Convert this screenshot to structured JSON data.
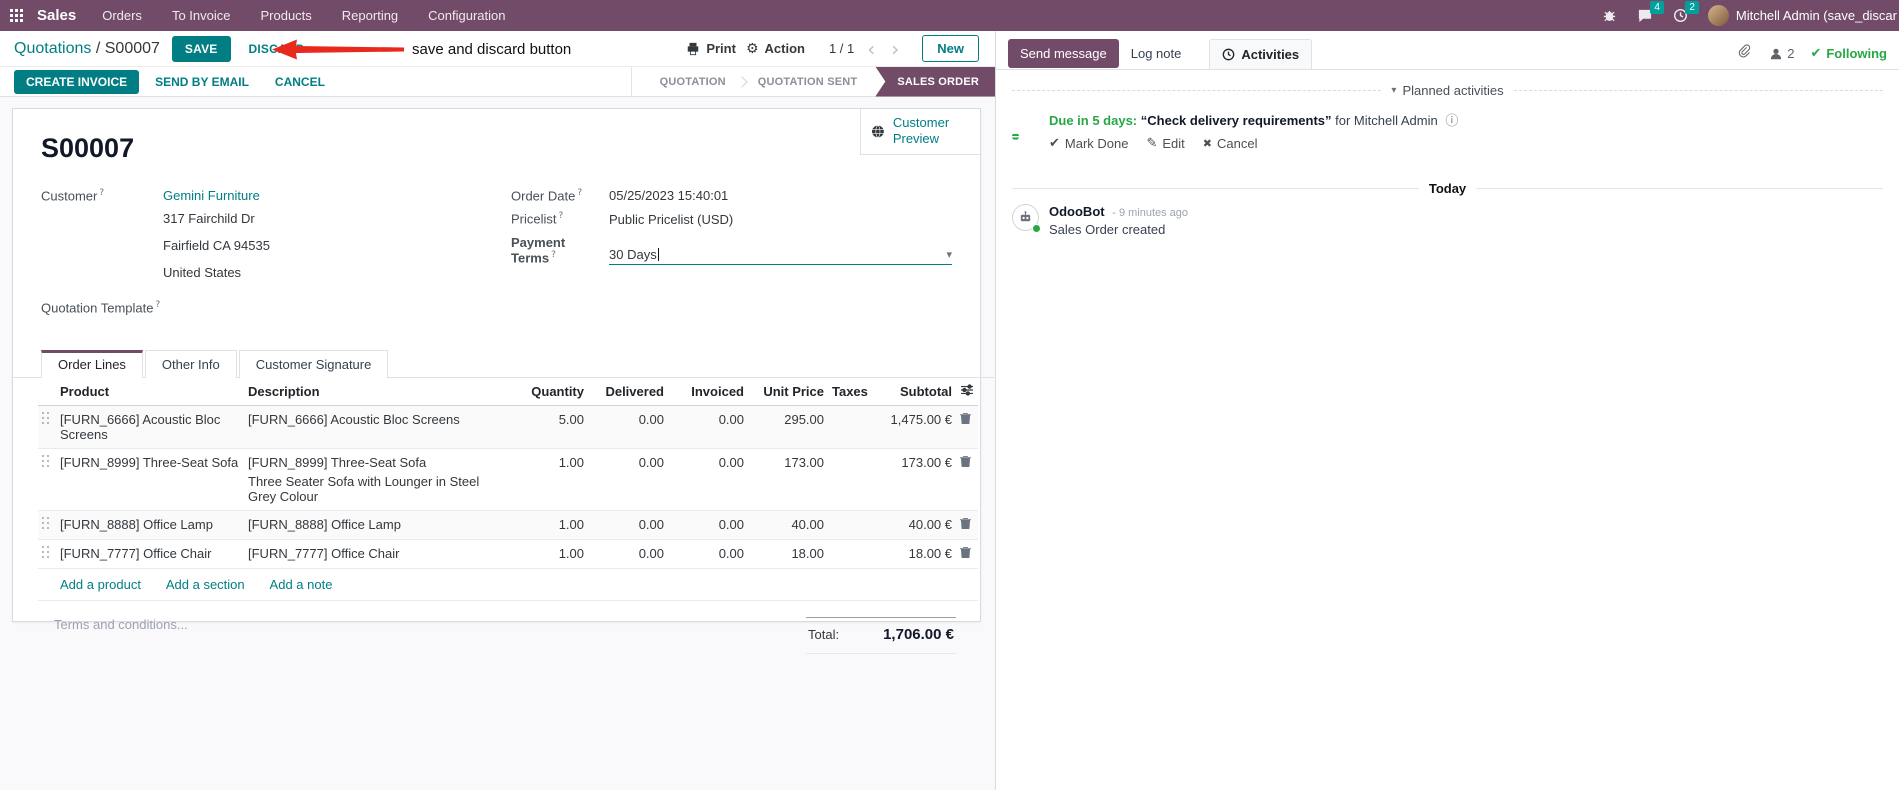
{
  "topbar": {
    "app_name": "Sales",
    "menus": [
      "Orders",
      "To Invoice",
      "Products",
      "Reporting",
      "Configuration"
    ],
    "message_badge": "4",
    "activity_badge": "2",
    "user_name": "Mitchell Admin (save_discar"
  },
  "breadcrumb": {
    "parent": "Quotations",
    "separator": "/",
    "current": "S00007",
    "save_label": "SAVE",
    "discard_label": "DISCARD",
    "annotation_text": "save and discard button",
    "print_label": "Print",
    "action_label": "Action",
    "pager": "1 / 1",
    "new_label": "New"
  },
  "statusbar": {
    "create_invoice": "CREATE INVOICE",
    "send_by_email": "SEND BY EMAIL",
    "cancel": "CANCEL",
    "states": [
      "QUOTATION",
      "QUOTATION SENT",
      "SALES ORDER"
    ],
    "active_state": "SALES ORDER"
  },
  "sheet": {
    "customer_preview": "Customer Preview",
    "record_name": "S00007",
    "fields": {
      "customer_label": "Customer",
      "customer_value": "Gemini Furniture",
      "address_line1": "317 Fairchild Dr",
      "address_line2": "Fairfield CA 94535",
      "address_line3": "United States",
      "quotation_template_label": "Quotation Template",
      "order_date_label": "Order Date",
      "order_date_value": "05/25/2023 15:40:01",
      "pricelist_label": "Pricelist",
      "pricelist_value": "Public Pricelist (USD)",
      "payment_terms_label": "Payment Terms",
      "payment_terms_value": "30 Days"
    },
    "tabs": [
      "Order Lines",
      "Other Info",
      "Customer Signature"
    ],
    "table": {
      "headers": [
        "Product",
        "Description",
        "Quantity",
        "Delivered",
        "Invoiced",
        "Unit Price",
        "Taxes",
        "Subtotal"
      ],
      "rows": [
        {
          "product": "[FURN_6666] Acoustic Bloc Screens",
          "description": "[FURN_6666] Acoustic Bloc Screens",
          "description2": "",
          "quantity": "5.00",
          "delivered": "0.00",
          "invoiced": "0.00",
          "unit_price": "295.00",
          "taxes": "",
          "subtotal": "1,475.00 €"
        },
        {
          "product": "[FURN_8999] Three-Seat Sofa",
          "description": "[FURN_8999] Three-Seat Sofa",
          "description2": "Three Seater Sofa with Lounger in Steel Grey Colour",
          "quantity": "1.00",
          "delivered": "0.00",
          "invoiced": "0.00",
          "unit_price": "173.00",
          "taxes": "",
          "subtotal": "173.00 €"
        },
        {
          "product": "[FURN_8888] Office Lamp",
          "description": "[FURN_8888] Office Lamp",
          "description2": "",
          "quantity": "1.00",
          "delivered": "0.00",
          "invoiced": "0.00",
          "unit_price": "40.00",
          "taxes": "",
          "subtotal": "40.00 €"
        },
        {
          "product": "[FURN_7777] Office Chair",
          "description": "[FURN_7777] Office Chair",
          "description2": "",
          "quantity": "1.00",
          "delivered": "0.00",
          "invoiced": "0.00",
          "unit_price": "18.00",
          "taxes": "",
          "subtotal": "18.00 €"
        }
      ],
      "add_product": "Add a product",
      "add_section": "Add a section",
      "add_note": "Add a note"
    },
    "terms_placeholder": "Terms and conditions...",
    "total_label": "Total:",
    "total_value": "1,706.00 €"
  },
  "chatter": {
    "send_message": "Send message",
    "log_note": "Log note",
    "activities_tab": "Activities",
    "followers_count": "2",
    "following_label": "Following",
    "planned_activities": "Planned activities",
    "activity": {
      "due": "Due in 5 days:",
      "title": "“Check delivery requirements”",
      "for_user": "for Mitchell Admin",
      "mark_done": "Mark Done",
      "edit": "Edit",
      "cancel": "Cancel"
    },
    "today_label": "Today",
    "message": {
      "author": "OdooBot",
      "time": "- 9 minutes ago",
      "body": "Sales Order created"
    }
  },
  "icons": {
    "gear": "⚙",
    "chevron_left": "‹",
    "chevron_right": "›",
    "caret_down": "▾",
    "check": "✔",
    "pencil": "✎",
    "cross": "✖",
    "info": "ⓘ",
    "help": "?"
  },
  "colors": {
    "brand_purple": "#714B67",
    "accent_teal": "#017E84",
    "badge_teal": "#00A09D",
    "success_green": "#28a745",
    "annotation_red": "#e8291c",
    "link_blue_cells": "#1f7fc1"
  }
}
